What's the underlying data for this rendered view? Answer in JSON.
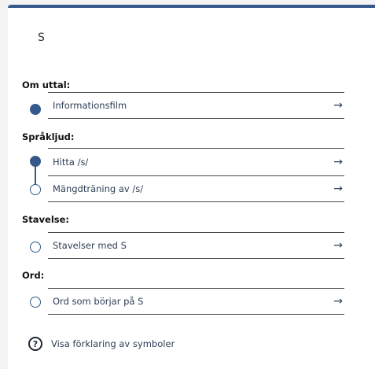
{
  "title": "S",
  "sections": [
    {
      "heading": "Om uttal:",
      "items": [
        {
          "label": "Informationsfilm",
          "arrow": "→",
          "state": "filled"
        }
      ]
    },
    {
      "heading": "Språkljud:",
      "items": [
        {
          "label": "Hitta /s/",
          "arrow": "→",
          "state": "filled"
        },
        {
          "label": "Mängdträning av /s/",
          "arrow": "→",
          "state": "empty"
        }
      ]
    },
    {
      "heading": "Stavelse:",
      "items": [
        {
          "label": "Stavelser med S",
          "arrow": "→",
          "state": "empty"
        }
      ]
    },
    {
      "heading": "Ord:",
      "items": [
        {
          "label": "Ord som börjar på S",
          "arrow": "→",
          "state": "empty"
        }
      ]
    }
  ],
  "help": {
    "label": "Visa förklaring av symboler",
    "icon": "?"
  },
  "colors": {
    "accent": "#35598a"
  }
}
